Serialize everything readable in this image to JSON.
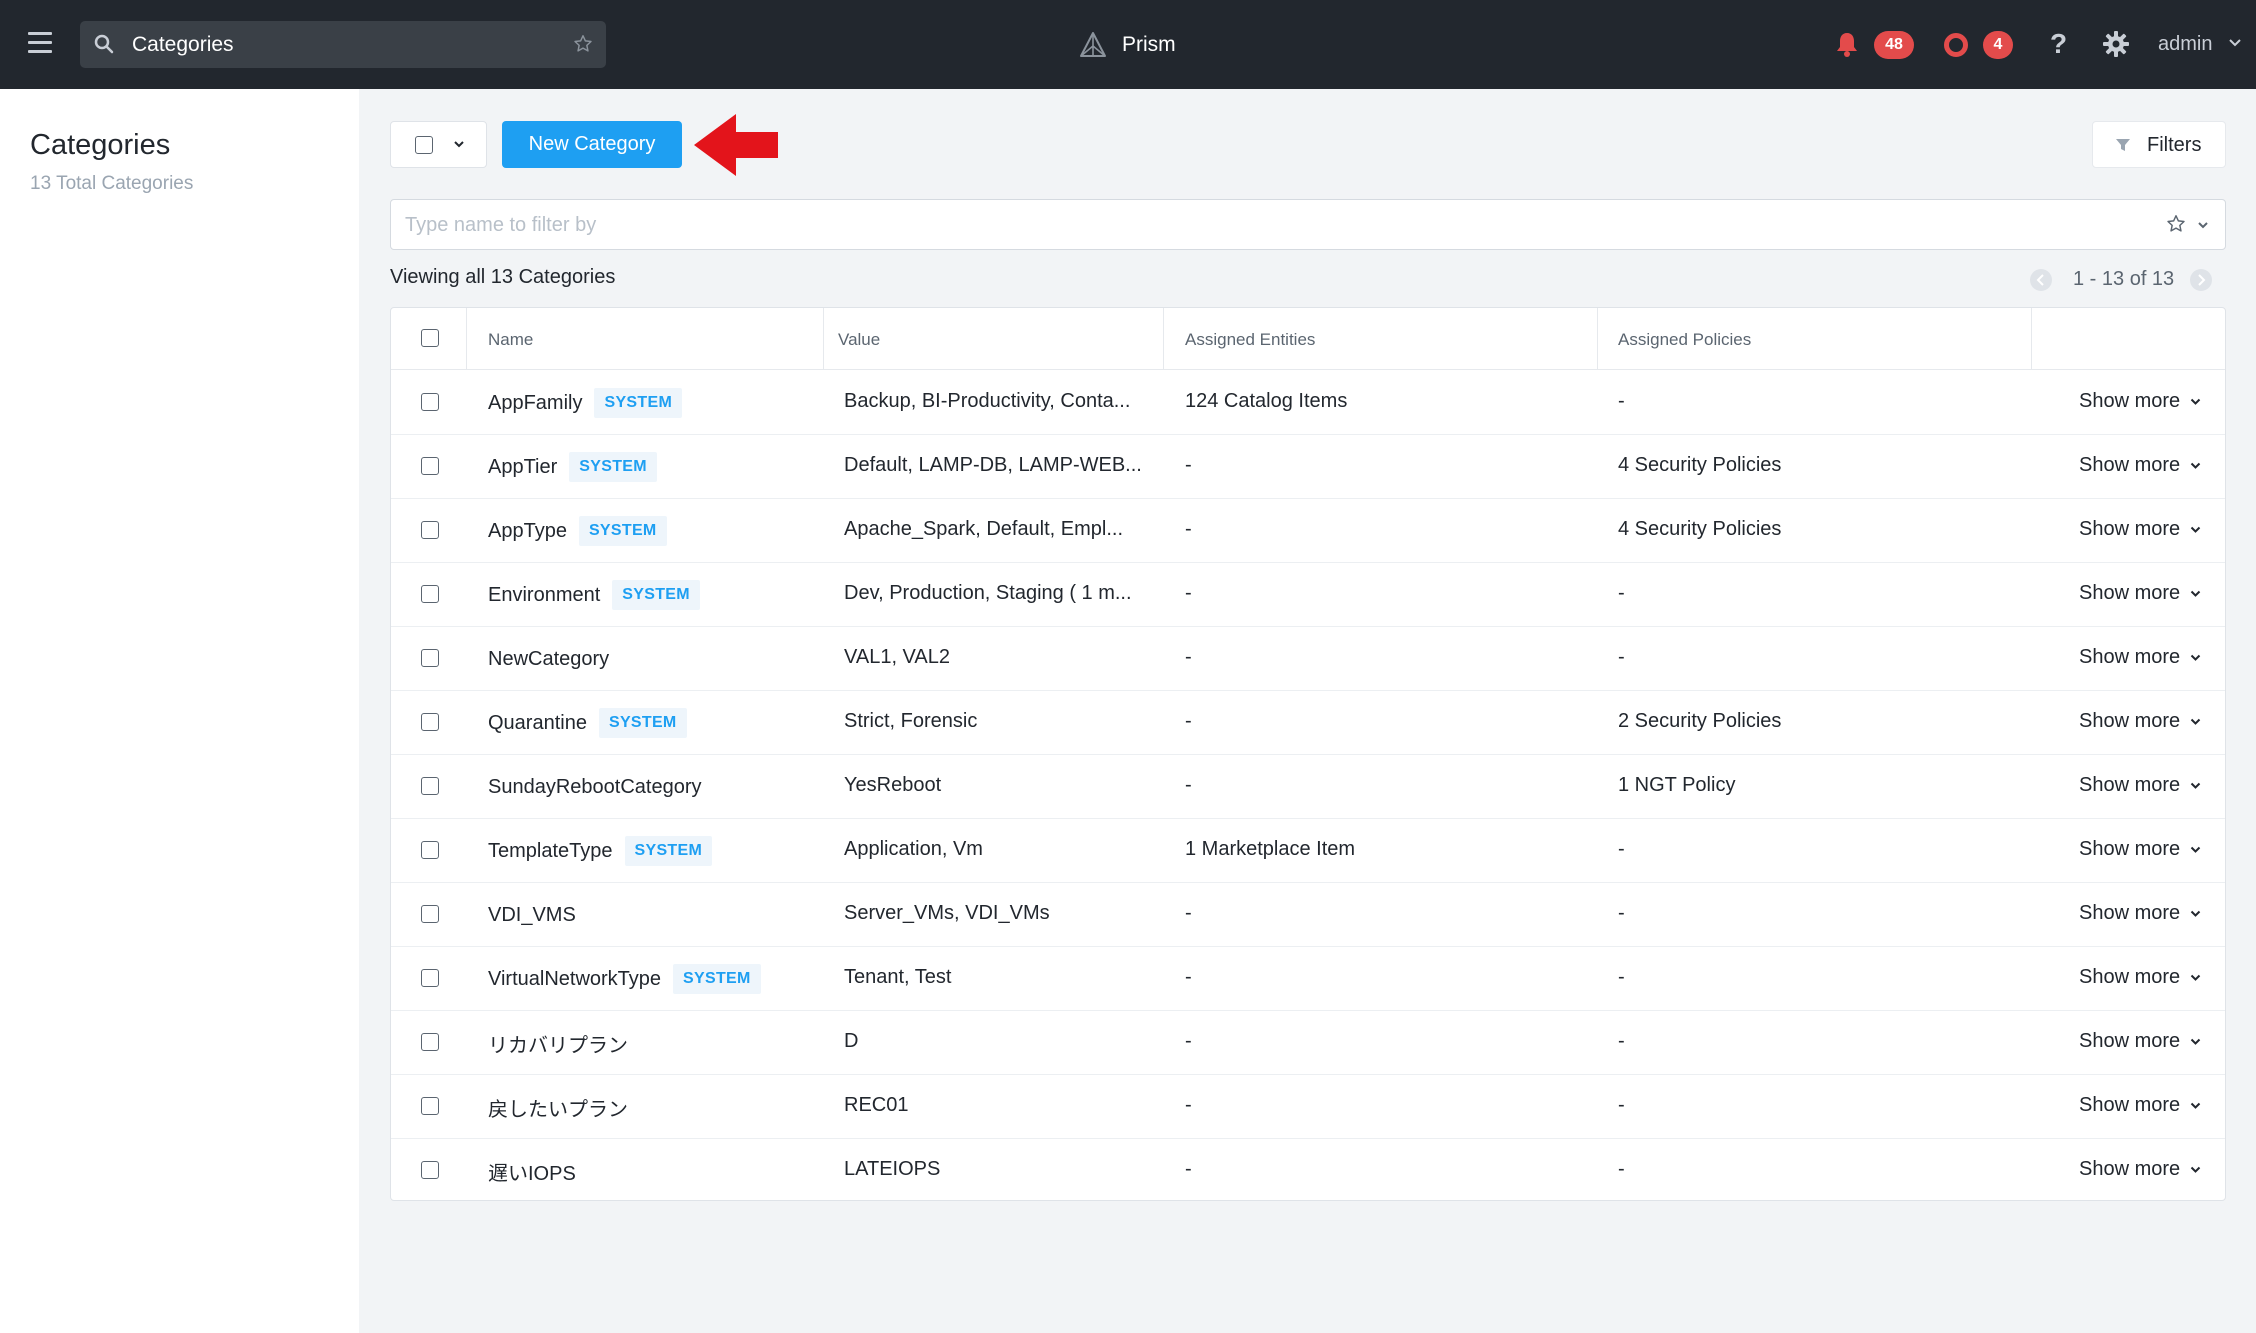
{
  "topbar": {
    "search_value": "Categories",
    "brand": "Prism",
    "alerts_count": "48",
    "events_count": "4",
    "help_label": "?",
    "user": "admin",
    "colors": {
      "background": "#22272e",
      "badge": "#e34b4b"
    }
  },
  "sidebar": {
    "title": "Categories",
    "subtitle": "13 Total Categories"
  },
  "toolbar": {
    "new_button": "New Category",
    "filters_label": "Filters",
    "accent_color": "#1e9ff2"
  },
  "filter": {
    "placeholder": "Type name to filter by"
  },
  "summary": {
    "viewing": "Viewing all 13 Categories",
    "pager": "1 - 13 of 13"
  },
  "table": {
    "headers": {
      "name": "Name",
      "value": "Value",
      "entities": "Assigned Entities",
      "policies": "Assigned Policies"
    },
    "rows": [
      {
        "name": "AppFamily",
        "tag": "SYSTEM",
        "value": "Backup, BI-Productivity, Conta...",
        "entities": "124 Catalog Items",
        "policies": "-",
        "more": "Show more"
      },
      {
        "name": "AppTier",
        "tag": "SYSTEM",
        "value": "Default, LAMP-DB, LAMP-WEB...",
        "entities": "-",
        "policies": "4 Security Policies",
        "more": "Show more"
      },
      {
        "name": "AppType",
        "tag": "SYSTEM",
        "value": "Apache_Spark, Default, Empl...",
        "entities": "-",
        "policies": "4 Security Policies",
        "more": "Show more"
      },
      {
        "name": "Environment",
        "tag": "SYSTEM",
        "value": "Dev, Production, Staging ( 1 m...",
        "entities": "-",
        "policies": "-",
        "more": "Show more"
      },
      {
        "name": "NewCategory",
        "tag": "",
        "value": "VAL1, VAL2",
        "entities": "-",
        "policies": "-",
        "more": "Show more"
      },
      {
        "name": "Quarantine",
        "tag": "SYSTEM",
        "value": "Strict, Forensic",
        "entities": "-",
        "policies": "2 Security Policies",
        "more": "Show more"
      },
      {
        "name": "SundayRebootCategory",
        "tag": "",
        "value": "YesReboot",
        "entities": "-",
        "policies": "1 NGT Policy",
        "more": "Show more"
      },
      {
        "name": "TemplateType",
        "tag": "SYSTEM",
        "value": "Application, Vm",
        "entities": "1 Marketplace Item",
        "policies": "-",
        "more": "Show more"
      },
      {
        "name": "VDI_VMS",
        "tag": "",
        "value": "Server_VMs, VDI_VMs",
        "entities": "-",
        "policies": "-",
        "more": "Show more"
      },
      {
        "name": "VirtualNetworkType",
        "tag": "SYSTEM",
        "value": "Tenant, Test",
        "entities": "-",
        "policies": "-",
        "more": "Show more"
      },
      {
        "name": "リカバリプラン",
        "tag": "",
        "value": "D",
        "entities": "-",
        "policies": "-",
        "more": "Show more"
      },
      {
        "name": "戻したいプラン",
        "tag": "",
        "value": "REC01",
        "entities": "-",
        "policies": "-",
        "more": "Show more"
      },
      {
        "name": "遅いIOPS",
        "tag": "",
        "value": "LATEIOPS",
        "entities": "-",
        "policies": "-",
        "more": "Show more"
      }
    ]
  }
}
